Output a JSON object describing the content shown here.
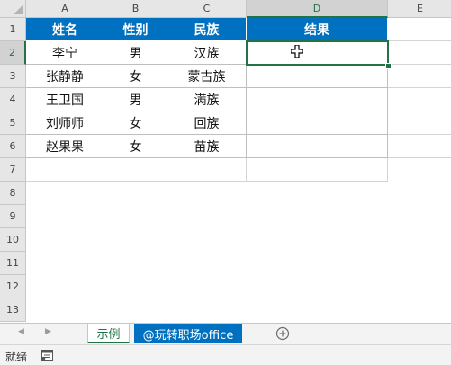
{
  "columns": [
    "A",
    "B",
    "C",
    "D",
    "E"
  ],
  "rows": [
    "1",
    "2",
    "3",
    "4",
    "5",
    "6",
    "7",
    "8",
    "9",
    "10",
    "11",
    "12",
    "13"
  ],
  "selected_column": "D",
  "selected_row": "2",
  "table": {
    "headers": [
      "姓名",
      "性别",
      "民族",
      "结果"
    ],
    "rows": [
      [
        "李宁",
        "男",
        "汉族",
        ""
      ],
      [
        "张静静",
        "女",
        "蒙古族",
        ""
      ],
      [
        "王卫国",
        "男",
        "满族",
        ""
      ],
      [
        "刘师师",
        "女",
        "回族",
        ""
      ],
      [
        "赵果果",
        "女",
        "苗族",
        ""
      ]
    ]
  },
  "sheets": {
    "active_label": "示例",
    "second_label": "@玩转职场office"
  },
  "status": {
    "ready_label": "就绪"
  },
  "icons": {
    "prev_sheet": "triangle-left-icon",
    "next_sheet": "triangle-right-icon",
    "add_sheet": "plus-circle-icon",
    "cursor": "cell-select-cursor-icon",
    "macro": "macro-record-icon"
  },
  "colors": {
    "header_fill": "#0070c0",
    "header_text": "#ffffff",
    "selection": "#217346",
    "second_tab_fill": "#0070c0"
  }
}
